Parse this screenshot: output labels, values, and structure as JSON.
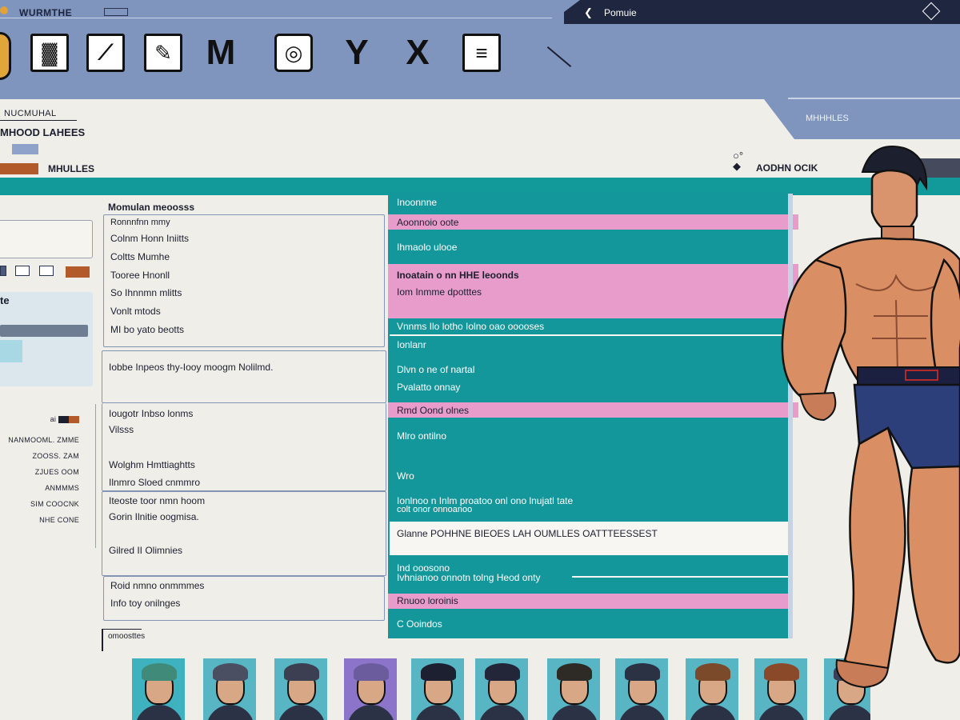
{
  "app": {
    "title": "WURMTHE",
    "nav_label": "Pomuie"
  },
  "header": {
    "subtitle": "NUCMUHAL",
    "title": "MHOOD LAHEES",
    "tab_label": "MHULLES",
    "modes_label": "MHHHLES",
    "action_label": "AODHN OCIK"
  },
  "toolbar": {
    "icons": [
      "chart-icon",
      "slash-box-icon",
      "edit-icon",
      "mountain-icon",
      "target-icon",
      "y-icon",
      "x-icon",
      "stack-icon"
    ]
  },
  "sidebar": {
    "card_title": "te",
    "stats": [
      {
        "label": "ai"
      },
      {
        "label": "NANMOOML. ZMME"
      },
      {
        "label": "ZOOSS. ZAM"
      },
      {
        "label": "ZJUES OOM"
      },
      {
        "label": "ANMMMS"
      },
      {
        "label": "SIM COOCNK"
      },
      {
        "label": "NHE CONE"
      }
    ]
  },
  "list": {
    "header": "Momulan meoosss",
    "group1": [
      "Ronnnfnn mmy",
      "Colnm Honn Iniitts",
      "Coltts Mumhe",
      "Tooree Hnonll",
      "So Ihnnmn mlitts",
      "Vonlt mtods",
      "MI bo yato beotts"
    ],
    "note": "Iobbe Inpeos thy-Iooy moogm Nolilmd.",
    "group2": [
      "Iougotr Inbso lonms",
      "Vilsss"
    ],
    "group3": [
      "Wolghm Hmttiaghtts",
      "Ilnmro Sloed cnmmro"
    ],
    "group4": [
      "Iteoste toor nmn hoom",
      "Gorin Ilnitie oogmisa.",
      "Gilred II Olimnies"
    ],
    "group5": [
      "Roid nmno onmmmes",
      "Info toy onilnges"
    ],
    "footer": "omoosttes"
  },
  "info": {
    "rows": [
      {
        "text": "Inoonnne",
        "style": "teal"
      },
      {
        "text": "Aoonnoio oote",
        "style": "pink"
      },
      {
        "text": "Ihmaolo ulooe",
        "style": "teal"
      },
      {
        "text": "Inoatain o nn HHE leoonds",
        "style": "pink-bold"
      },
      {
        "text": "Iom Inmme dpotttes",
        "style": "pink"
      },
      {
        "text": "Vnnms Ilo lotho Iolno oao ooooses",
        "style": "teal"
      },
      {
        "text": "Ionlanr",
        "style": "teal"
      },
      {
        "text": "Dlvn o ne of nartal",
        "style": "teal"
      },
      {
        "text": "Pvalatto onnay",
        "style": "teal"
      },
      {
        "text": "Rmd Oond olnes",
        "style": "pink"
      },
      {
        "text": "Mlro ontilno",
        "style": "teal"
      },
      {
        "text": "Wro",
        "style": "teal"
      },
      {
        "text": "Ionlnoo n Inlm proatoo onl ono lnujatl tate",
        "style": "teal"
      },
      {
        "text": "colt onor onnoanoo",
        "style": "teal"
      },
      {
        "text": "Glanne POHHNE BIEOES LAH OUMLLES OATTTEESSEST",
        "style": "white"
      },
      {
        "text": "Ind ooosono",
        "style": "teal"
      },
      {
        "text": "Ivhnianoo onnotn tolng Heod onty",
        "style": "teal"
      },
      {
        "text": "Rnuoo loroinis",
        "style": "pink"
      },
      {
        "text": "C Ooindos",
        "style": "teal"
      }
    ]
  },
  "roster": {
    "portraits": [
      "#3f8a78",
      "#4a4f62",
      "#3c3f52",
      "#6b5c9e",
      "#1d2030",
      "#222638",
      "#2e2a26",
      "#2a3244",
      "#7a4a2a",
      "#8a4a2a",
      "#3a3f55"
    ],
    "portrait_bg": [
      "#3fb2bf",
      "#58b6c4",
      "#58b6c4",
      "#8b74c9",
      "#58b6c4",
      "#58b6c4",
      "#58b6c4",
      "#58b6c4",
      "#58b6c4",
      "#58b6c4",
      "#58b6c4"
    ]
  },
  "colors": {
    "accent_teal": "#14979a",
    "accent_pink": "#e89ccb",
    "header_blue": "#7f95bd",
    "rust": "#b35a2a"
  }
}
